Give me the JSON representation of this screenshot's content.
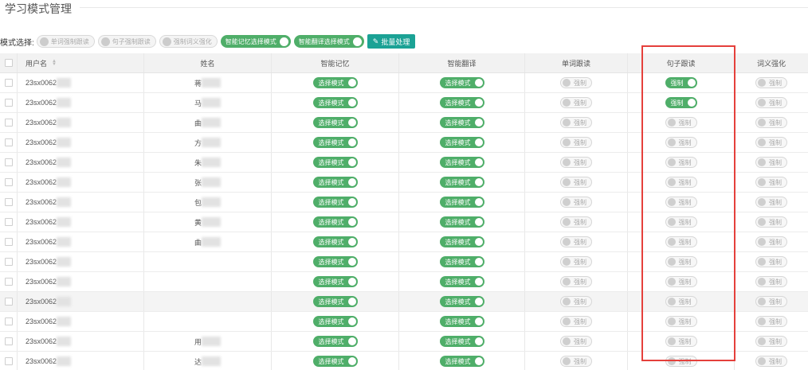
{
  "page": {
    "title": "学习模式管理"
  },
  "toolbar": {
    "label": "模式选择:",
    "pills": [
      {
        "label": "单词强制跟读",
        "state": "off"
      },
      {
        "label": "句子强制跟读",
        "state": "off"
      },
      {
        "label": "强制词义强化",
        "state": "off"
      },
      {
        "label": "智能记忆选择模式",
        "state": "on"
      },
      {
        "label": "智能翻译选择模式",
        "state": "on"
      }
    ],
    "batch_button": "批量处理"
  },
  "table": {
    "headers": {
      "username": "用户名",
      "name": "姓名",
      "memory": "智能记忆",
      "translate": "智能翻译",
      "word_follow": "单词跟读",
      "sentence_follow": "句子跟读",
      "synonym": "词义强化"
    },
    "select_mode_label": "选择模式",
    "force_label": "强制",
    "rows": [
      {
        "username": "23sx0062",
        "surname": "蒋",
        "sentence": "on"
      },
      {
        "username": "23sx0062",
        "surname": "马",
        "sentence": "on"
      },
      {
        "username": "23sx0062",
        "surname": "曲",
        "sentence": "off"
      },
      {
        "username": "23sx0062",
        "surname": "方",
        "sentence": "off"
      },
      {
        "username": "23sx0062",
        "surname": "朱",
        "sentence": "off"
      },
      {
        "username": "23sx0062",
        "surname": "张",
        "sentence": "off"
      },
      {
        "username": "23sx0062",
        "surname": "包",
        "sentence": "off"
      },
      {
        "username": "23sx0062",
        "surname": "黄",
        "sentence": "off"
      },
      {
        "username": "23sx0062",
        "surname": "曲",
        "sentence": "off"
      },
      {
        "username": "23sx0062",
        "surname": "",
        "sentence": "off"
      },
      {
        "username": "23sx0062",
        "surname": "",
        "sentence": "off"
      },
      {
        "username": "23sx0062",
        "surname": "",
        "sentence": "off"
      },
      {
        "username": "23sx0062",
        "surname": "",
        "sentence": "off"
      },
      {
        "username": "23sx0062",
        "surname": "用",
        "sentence": "off"
      },
      {
        "username": "23sx0062",
        "surname": "达",
        "sentence": "off"
      }
    ]
  },
  "colors": {
    "green": "#4fae69",
    "teal": "#1ba295",
    "highlight": "#e5403b"
  }
}
